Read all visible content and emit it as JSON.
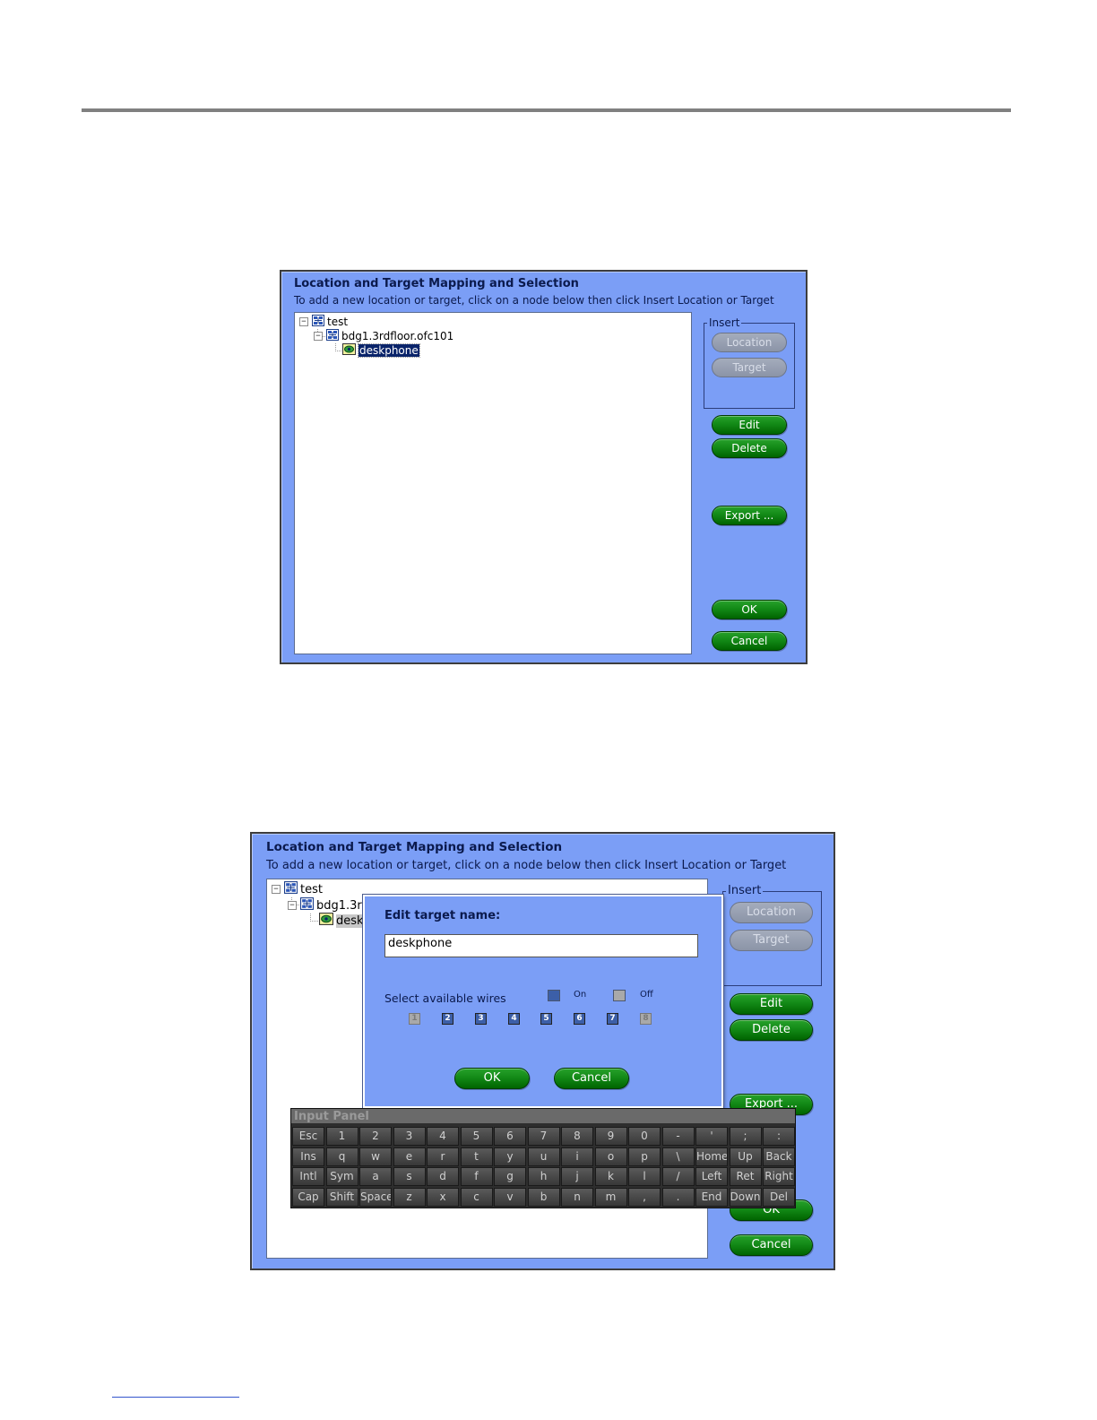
{
  "screen1": {
    "title": "Location and Target Mapping and Selection",
    "instruction": "To add a new location or target, click on a node below then click Insert Location or Target",
    "tree": {
      "root": "test",
      "location": "bdg1.3rdfloor.ofc101",
      "target": "deskphone"
    },
    "insert_group": {
      "legend": "Insert",
      "location_label": "Location",
      "target_label": "Target"
    },
    "buttons": {
      "edit": "Edit",
      "delete": "Delete",
      "export": "Export ...",
      "ok": "OK",
      "cancel": "Cancel"
    }
  },
  "screen2": {
    "title": "Location and Target Mapping and Selection",
    "instruction": "To add a new location or target, click on a node below then click Insert Location or Target",
    "tree": {
      "root": "test",
      "location_visible": "bdg1.3r",
      "target_visible": "desk"
    },
    "insert_group": {
      "legend": "Insert",
      "location_label": "Location",
      "target_label": "Target"
    },
    "buttons": {
      "edit": "Edit",
      "delete": "Delete",
      "export_visible": "Export ...",
      "ok_visible": "OK",
      "cancel": "Cancel"
    },
    "edit_popup": {
      "heading": "Edit target name:",
      "name_value": "deskphone",
      "wires_label": "Select available wires",
      "legend_on": "On",
      "legend_off": "Off",
      "wires": [
        {
          "label": "1",
          "state": "off"
        },
        {
          "label": "2",
          "state": "on"
        },
        {
          "label": "3",
          "state": "on"
        },
        {
          "label": "4",
          "state": "on"
        },
        {
          "label": "5",
          "state": "on"
        },
        {
          "label": "6",
          "state": "on"
        },
        {
          "label": "7",
          "state": "on"
        },
        {
          "label": "8",
          "state": "off"
        }
      ],
      "ok": "OK",
      "cancel": "Cancel"
    },
    "input_panel": {
      "title": "Input Panel",
      "rows": [
        [
          "Esc",
          "1",
          "2",
          "3",
          "4",
          "5",
          "6",
          "7",
          "8",
          "9",
          "0",
          "-",
          "'",
          ";",
          ":"
        ],
        [
          "Ins",
          "q",
          "w",
          "e",
          "r",
          "t",
          "y",
          "u",
          "i",
          "o",
          "p",
          "\\",
          "Home",
          "Up",
          "Back"
        ],
        [
          "Intl",
          "Sym",
          "a",
          "s",
          "d",
          "f",
          "g",
          "h",
          "j",
          "k",
          "l",
          "/",
          "Left",
          "Ret",
          "Right"
        ],
        [
          "Cap",
          "Shift",
          "Space",
          "z",
          "x",
          "c",
          "v",
          "b",
          "n",
          "m",
          ",",
          ".",
          "End",
          "Down",
          "Del"
        ]
      ]
    }
  },
  "colors": {
    "dialog_bg": "#7b9ef6",
    "button_green": "#138a17",
    "button_disabled": "#8b94a7",
    "selection": "#0a246a",
    "wire_on": "#3c5fa8",
    "wire_off": "#a9a9a9",
    "keyboard_bg": "#2e2e2e"
  }
}
